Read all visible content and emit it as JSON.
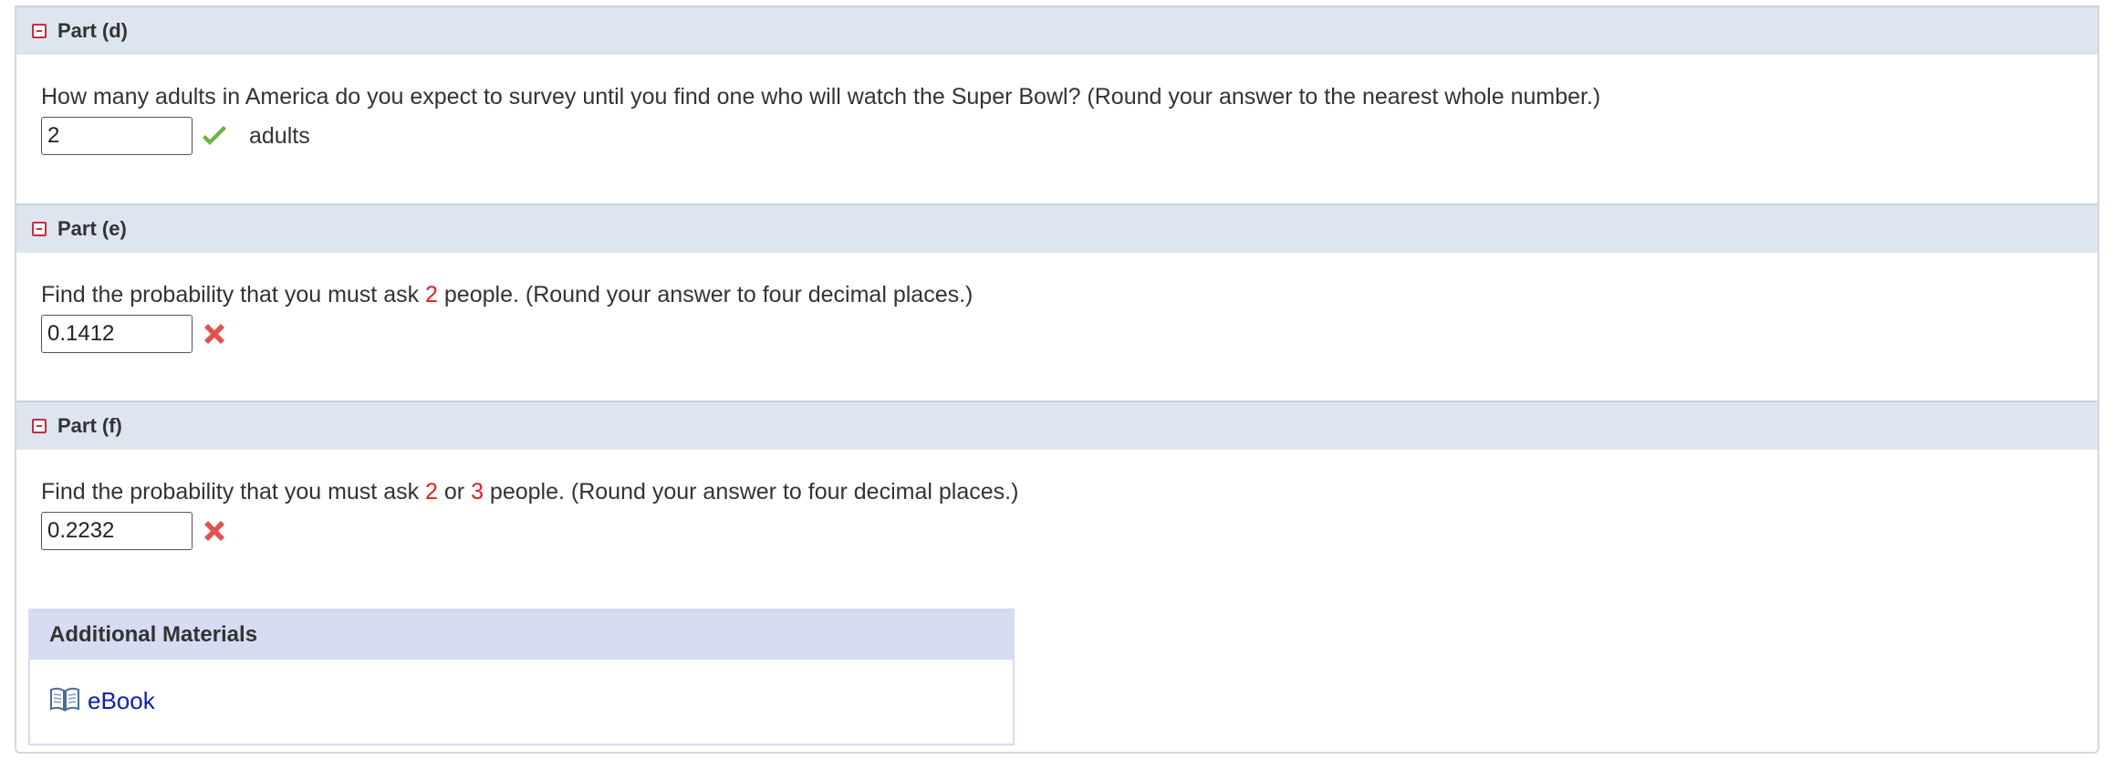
{
  "parts": [
    {
      "title": "Part (d)",
      "question": "How many adults in America do you expect to survey until you find one who will watch the Super Bowl? (Round your answer to the nearest whole number.)",
      "answer": "2",
      "unit": "adults",
      "status": "correct",
      "status_icon": "checkmark-icon",
      "status_color": "#6db33f"
    },
    {
      "title": "Part (e)",
      "question_prefix": "Find the probability that you must ask ",
      "highlight_1": "2",
      "question_suffix": " people. (Round your answer to four decimal places.)",
      "answer": "0.1412",
      "status": "incorrect",
      "status_icon": "x-icon",
      "status_color": "#e2524d"
    },
    {
      "title": "Part (f)",
      "question_prefix": "Find the probability that you must ask ",
      "highlight_1": "2",
      "question_mid": " or ",
      "highlight_2": "3",
      "question_suffix": " people. (Round your answer to four decimal places.)",
      "answer": "0.2232",
      "status": "incorrect",
      "status_icon": "x-icon",
      "status_color": "#e2524d"
    }
  ],
  "additional_materials": {
    "title": "Additional Materials",
    "items": [
      {
        "label": "eBook",
        "icon": "book-icon"
      }
    ]
  },
  "colors": {
    "header_bg": "#dde5ef",
    "highlight": "#e0211d",
    "link": "#0b20b5",
    "additional_header_bg": "#d5dcf3"
  }
}
